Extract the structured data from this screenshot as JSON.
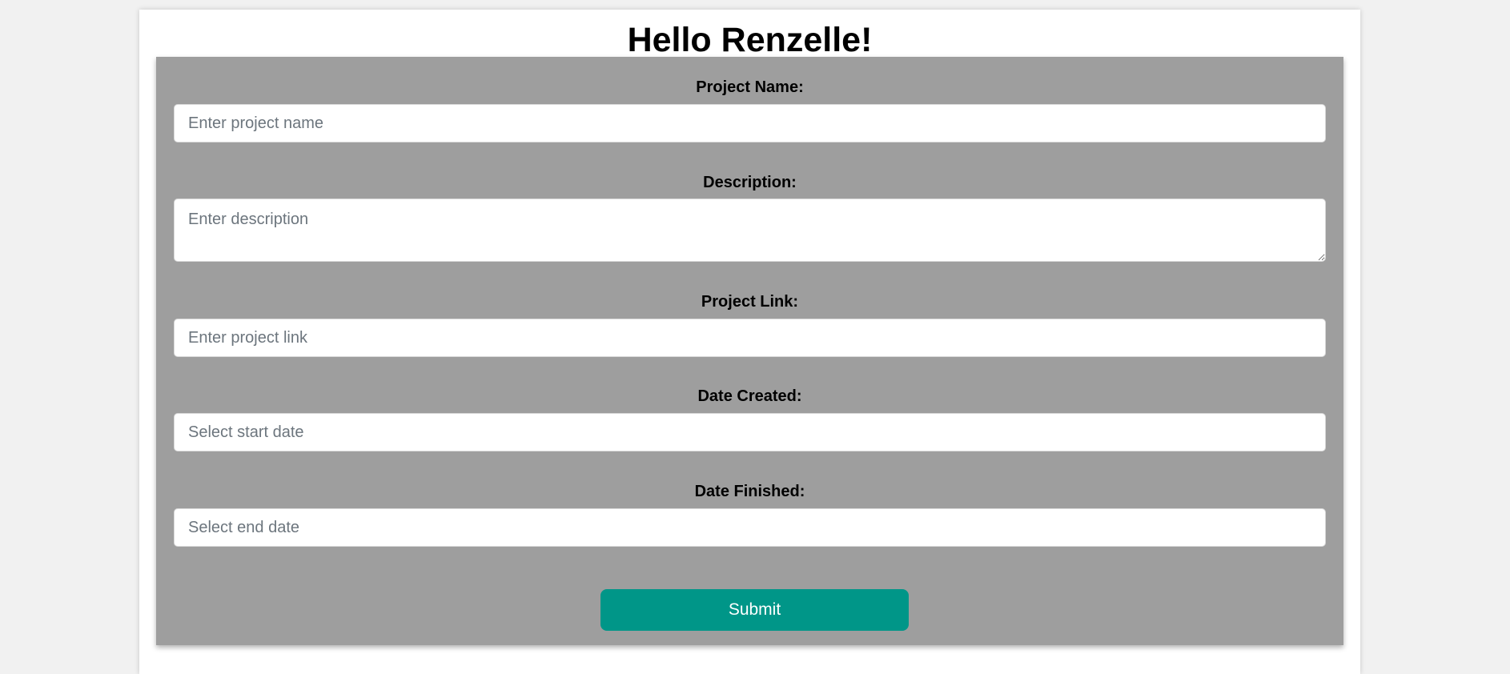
{
  "header": {
    "greeting": "Hello Renzelle!"
  },
  "form": {
    "project_name": {
      "label": "Project Name:",
      "placeholder": "Enter project name"
    },
    "description": {
      "label": "Description:",
      "placeholder": "Enter description"
    },
    "project_link": {
      "label": "Project Link:",
      "placeholder": "Enter project link"
    },
    "date_created": {
      "label": "Date Created:",
      "placeholder": "Select start date"
    },
    "date_finished": {
      "label": "Date Finished:",
      "placeholder": "Select end date"
    },
    "submit_label": "Submit"
  },
  "colors": {
    "page_background": "#f1f1f1",
    "card_background": "#9e9e9e",
    "submit_button": "#009688"
  }
}
